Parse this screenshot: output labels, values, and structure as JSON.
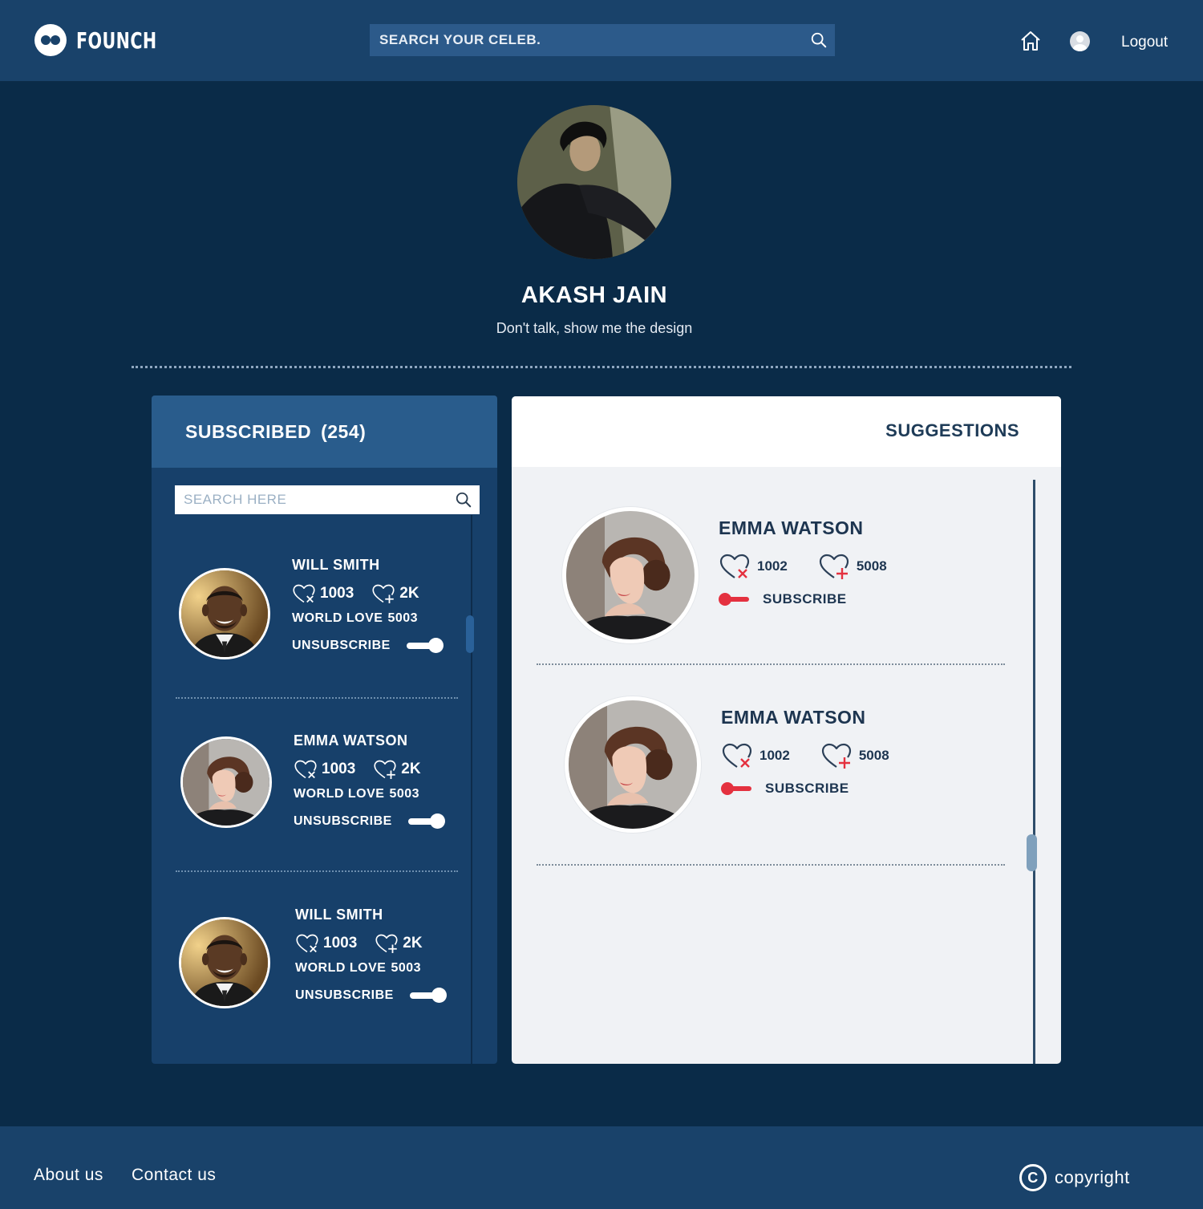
{
  "header": {
    "brand": "FOUNCH",
    "search_placeholder": "SEARCH YOUR CELEB.",
    "logout_label": "Logout"
  },
  "profile": {
    "name": "AKASH JAIN",
    "bio": "Don't talk, show me the design"
  },
  "subscribed": {
    "title": "SUBSCRIBED",
    "count": "(254)",
    "search_placeholder": "SEARCH HERE",
    "items": [
      {
        "name": "WILL SMITH",
        "broken": "1003",
        "loved": "2K",
        "world_label": "WORLD LOVE",
        "world_value": "5003",
        "action": "UNSUBSCRIBE"
      },
      {
        "name": "EMMA WATSON",
        "broken": "1003",
        "loved": "2K",
        "world_label": "WORLD LOVE",
        "world_value": "5003",
        "action": "UNSUBSCRIBE"
      },
      {
        "name": "WILL SMITH",
        "broken": "1003",
        "loved": "2K",
        "world_label": "WORLD LOVE",
        "world_value": "5003",
        "action": "UNSUBSCRIBE"
      }
    ]
  },
  "suggestions": {
    "title": "SUGGESTIONS",
    "items": [
      {
        "name": "EMMA WATSON",
        "broken": "1002",
        "loved": "5008",
        "action": "SUBSCRIBE"
      },
      {
        "name": "EMMA WATSON",
        "broken": "1002",
        "loved": "5008",
        "action": "SUBSCRIBE"
      }
    ]
  },
  "footer": {
    "about": "About us",
    "contact": "Contact us",
    "copyright": "copyright",
    "copyright_symbol": "C"
  },
  "colors": {
    "header_bg": "#19426a",
    "page_bg": "#0a2b48",
    "panel_header": "#295c8c",
    "accent_red": "#e4313f"
  }
}
